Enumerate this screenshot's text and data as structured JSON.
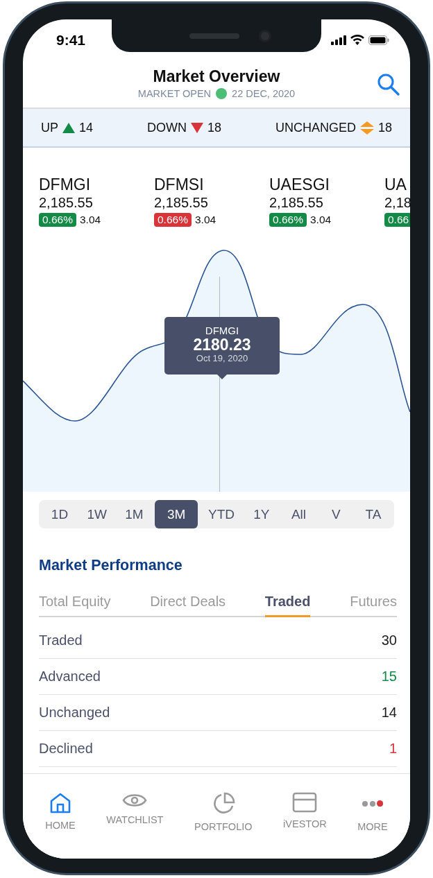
{
  "status_bar": {
    "time": "9:41"
  },
  "header": {
    "title": "Market Overview",
    "status": "MARKET OPEN",
    "open": true,
    "date": "22 DEC, 2020"
  },
  "summary": [
    {
      "kind": "up",
      "label": "UP",
      "count": "14"
    },
    {
      "kind": "down",
      "label": "DOWN",
      "count": "18"
    },
    {
      "kind": "unchanged",
      "label": "UNCHANGED",
      "count": "18"
    }
  ],
  "tickers": [
    {
      "symbol": "DFMGI",
      "price": "2,185.55",
      "change_pct": "0.66%",
      "change": "3.04",
      "color": "#138a46"
    },
    {
      "symbol": "DFMSI",
      "price": "2,185.55",
      "change_pct": "0.66%",
      "change": "3.04",
      "color": "#d8343a"
    },
    {
      "symbol": "UAESGI",
      "price": "2,185.55",
      "change_pct": "0.66%",
      "change": "3.04",
      "color": "#138a46"
    },
    {
      "symbol": "UA",
      "price": "2,18",
      "change_pct": "0.66",
      "color": "#138a46"
    }
  ],
  "chart_tooltip": {
    "symbol": "DFMGI",
    "value": "2180.23",
    "date": "Oct 19, 2020"
  },
  "ranges": [
    {
      "label": "1D",
      "selected": false
    },
    {
      "label": "1W",
      "selected": false
    },
    {
      "label": "1M",
      "selected": false
    },
    {
      "label": "3M",
      "selected": true
    },
    {
      "label": "YTD",
      "selected": false
    },
    {
      "label": "1Y",
      "selected": false
    },
    {
      "label": "All",
      "selected": false
    },
    {
      "label": "V",
      "selected": false
    },
    {
      "label": "TA",
      "selected": false
    }
  ],
  "market_performance": {
    "title": "Market Performance",
    "tabs": [
      {
        "label": "Total Equity",
        "selected": false
      },
      {
        "label": "Direct Deals",
        "selected": false
      },
      {
        "label": "Traded",
        "selected": true
      },
      {
        "label": "Futures",
        "selected": false
      }
    ],
    "rows": [
      {
        "label": "Traded",
        "value": "30",
        "kind": "neutral"
      },
      {
        "label": "Advanced",
        "value": "15",
        "kind": "up"
      },
      {
        "label": "Unchanged",
        "value": "14",
        "kind": "neutral"
      },
      {
        "label": "Declined",
        "value": "1",
        "kind": "down"
      }
    ]
  },
  "nav": [
    {
      "kind": "home",
      "label": "HOME",
      "selected": true
    },
    {
      "kind": "watchlist",
      "label": "WATCHLIST",
      "selected": false
    },
    {
      "kind": "portfolio",
      "label": "PORTFOLIO",
      "selected": false
    },
    {
      "kind": "ivestor",
      "label": "iVESTOR",
      "selected": false
    },
    {
      "kind": "more",
      "label": "MORE",
      "selected": false,
      "badge": true
    }
  ]
}
